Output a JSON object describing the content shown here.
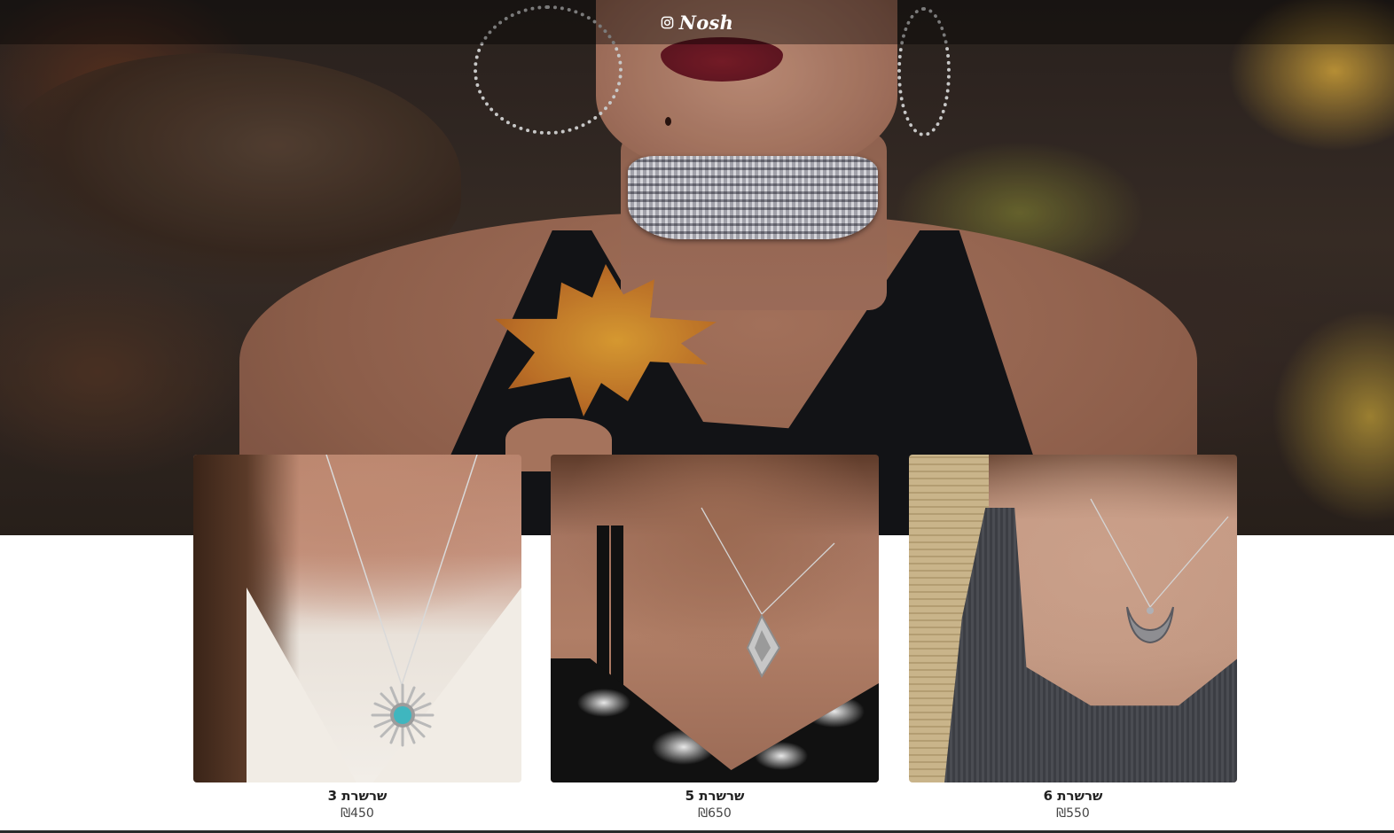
{
  "navbar": {
    "brand_name": "Nosh",
    "brand_icon": "instagram-icon"
  },
  "hero": {
    "image": "model-with-choker-and-maple-leaf"
  },
  "products": [
    {
      "title": "שרשרת 3",
      "price": "₪450",
      "image": "sun-pendant-turquoise"
    },
    {
      "title": "שרשרת 5",
      "price": "₪650",
      "image": "diamond-pendant"
    },
    {
      "title": "שרשרת 6",
      "price": "₪550",
      "image": "crescent-horn-pendant"
    }
  ],
  "colors": {
    "navbar_overlay": "#000000",
    "text_primary": "#222222",
    "text_price": "#444444",
    "page_background": "#ffffff"
  }
}
